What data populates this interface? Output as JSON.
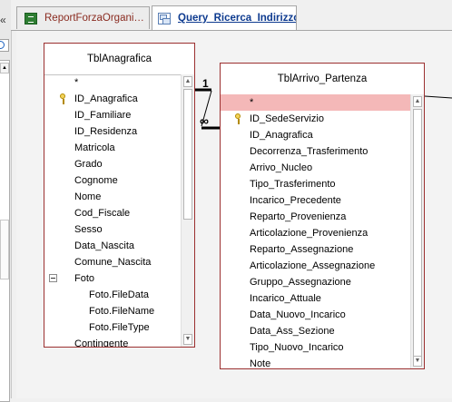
{
  "nav": {
    "collapse_glyph": "«"
  },
  "tabs": [
    {
      "label": "ReportForzaOrgani…",
      "icon": "report-icon",
      "active": false
    },
    {
      "label": "Query_Ricerca_Indirizzo",
      "icon": "query-icon",
      "active": true
    }
  ],
  "tables": {
    "anagrafica": {
      "title": "TblAnagrafica",
      "fields": [
        {
          "name": "*",
          "indent": 0
        },
        {
          "name": "ID_Anagrafica",
          "indent": 0,
          "key": true
        },
        {
          "name": "ID_Familiare",
          "indent": 0
        },
        {
          "name": "ID_Residenza",
          "indent": 0
        },
        {
          "name": "Matricola",
          "indent": 0
        },
        {
          "name": "Grado",
          "indent": 0
        },
        {
          "name": "Cognome",
          "indent": 0
        },
        {
          "name": "Nome",
          "indent": 0
        },
        {
          "name": "Cod_Fiscale",
          "indent": 0
        },
        {
          "name": "Sesso",
          "indent": 0
        },
        {
          "name": "Data_Nascita",
          "indent": 0
        },
        {
          "name": "Comune_Nascita",
          "indent": 0
        },
        {
          "name": "Foto",
          "indent": 0,
          "expand": true
        },
        {
          "name": "Foto.FileData",
          "indent": 1
        },
        {
          "name": "Foto.FileName",
          "indent": 1
        },
        {
          "name": "Foto.FileType",
          "indent": 1
        },
        {
          "name": "Contingente",
          "indent": 0
        }
      ]
    },
    "arrivo": {
      "title": "TblArrivo_Partenza",
      "fields": [
        {
          "name": "*",
          "indent": 0,
          "selected": true
        },
        {
          "name": "ID_SedeServizio",
          "indent": 0,
          "key": true
        },
        {
          "name": "ID_Anagrafica",
          "indent": 0
        },
        {
          "name": "Decorrenza_Trasferimento",
          "indent": 0
        },
        {
          "name": "Arrivo_Nucleo",
          "indent": 0
        },
        {
          "name": "Tipo_Trasferimento",
          "indent": 0
        },
        {
          "name": "Incarico_Precedente",
          "indent": 0
        },
        {
          "name": "Reparto_Provenienza",
          "indent": 0
        },
        {
          "name": "Articolazione_Provenienza",
          "indent": 0
        },
        {
          "name": "Reparto_Assegnazione",
          "indent": 0
        },
        {
          "name": "Articolazione_Assegnazione",
          "indent": 0
        },
        {
          "name": "Gruppo_Assegnazione",
          "indent": 0
        },
        {
          "name": "Incarico_Attuale",
          "indent": 0
        },
        {
          "name": "Data_Nuovo_Incarico",
          "indent": 0
        },
        {
          "name": "Data_Ass_Sezione",
          "indent": 0
        },
        {
          "name": "Tipo_Nuovo_Incarico",
          "indent": 0
        },
        {
          "name": "Note",
          "indent": 0
        }
      ]
    }
  },
  "relationship": {
    "one_side": "1",
    "many_side": "∞"
  },
  "colors": {
    "table_border": "#9b3030",
    "selected_row": "#f4b8b8",
    "active_tab_text": "#0d3a8f"
  }
}
